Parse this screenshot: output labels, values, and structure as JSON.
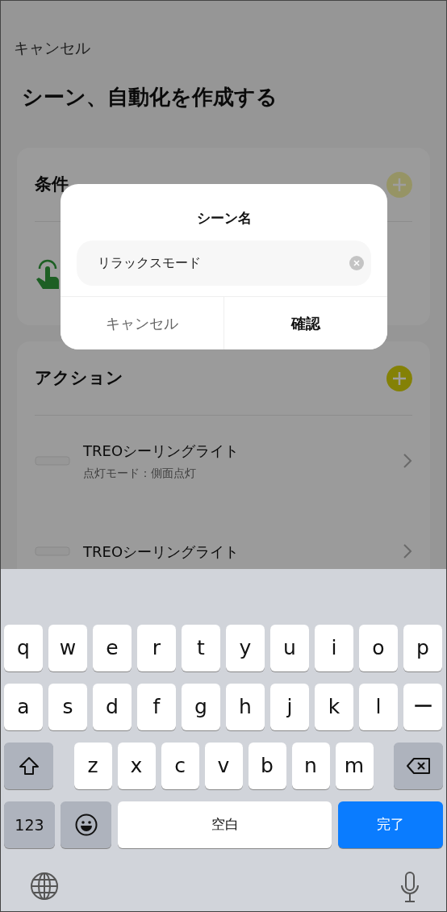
{
  "nav": {
    "cancel": "キャンセル"
  },
  "title": "シーン、自動化を作成する",
  "trigger_section": {
    "title": "条件",
    "add_disabled": true
  },
  "action_section": {
    "title": "アクション",
    "add_disabled": false,
    "items": [
      {
        "name": "TREOシーリングライト",
        "detail": "点灯モード：側面点灯"
      },
      {
        "name": "TREOシーリングライト"
      }
    ]
  },
  "dialog": {
    "title": "シーン名",
    "value": "リラックスモード",
    "buttons": [
      {
        "label": "キャンセル",
        "primary": false
      },
      {
        "label": "確認",
        "primary": true
      }
    ]
  },
  "keyboard": {
    "rows": [
      [
        {
          "kind": "letter",
          "label": "q"
        },
        {
          "kind": "letter",
          "label": "w"
        },
        {
          "kind": "letter",
          "label": "e"
        },
        {
          "kind": "letter",
          "label": "r"
        },
        {
          "kind": "letter",
          "label": "t"
        },
        {
          "kind": "letter",
          "label": "y"
        },
        {
          "kind": "letter",
          "label": "u"
        },
        {
          "kind": "letter",
          "label": "i"
        },
        {
          "kind": "letter",
          "label": "o"
        },
        {
          "kind": "letter",
          "label": "p"
        }
      ],
      [
        {
          "kind": "letter",
          "label": "a"
        },
        {
          "kind": "letter",
          "label": "s"
        },
        {
          "kind": "letter",
          "label": "d"
        },
        {
          "kind": "letter",
          "label": "f"
        },
        {
          "kind": "letter",
          "label": "g"
        },
        {
          "kind": "letter",
          "label": "h"
        },
        {
          "kind": "letter",
          "label": "j"
        },
        {
          "kind": "letter",
          "label": "k"
        },
        {
          "kind": "letter",
          "label": "l"
        },
        {
          "kind": "letter",
          "label": "ー"
        }
      ],
      [
        {
          "kind": "shift"
        },
        {
          "kind": "letter",
          "label": "z"
        },
        {
          "kind": "letter",
          "label": "x"
        },
        {
          "kind": "letter",
          "label": "c"
        },
        {
          "kind": "letter",
          "label": "v"
        },
        {
          "kind": "letter",
          "label": "b"
        },
        {
          "kind": "letter",
          "label": "n"
        },
        {
          "kind": "letter",
          "label": "m"
        },
        {
          "kind": "delete"
        }
      ],
      [
        {
          "kind": "numbers",
          "label": "123"
        },
        {
          "kind": "emoji"
        },
        {
          "kind": "space",
          "label": "空白"
        },
        {
          "kind": "done",
          "label": "完了"
        }
      ]
    ]
  }
}
